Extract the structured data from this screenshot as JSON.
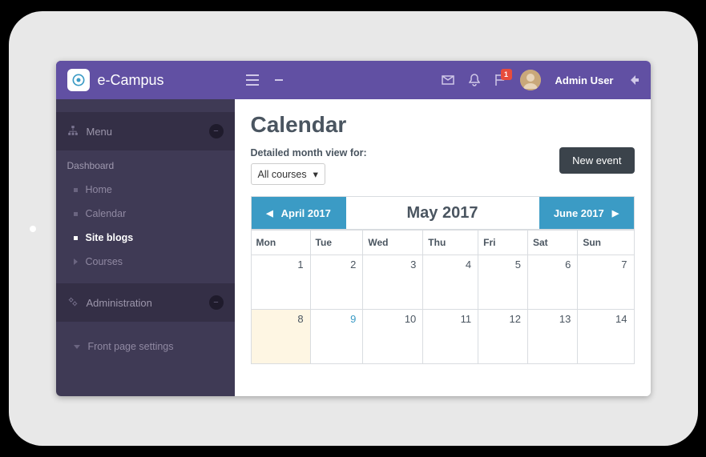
{
  "brand": {
    "name": "e-Campus"
  },
  "sidebar": {
    "menu_label": "Menu",
    "group1_title": "Dashboard",
    "items": [
      {
        "label": "Home",
        "active": false
      },
      {
        "label": "Calendar",
        "active": false
      },
      {
        "label": "Site blogs",
        "active": true
      },
      {
        "label": "Courses",
        "active": false,
        "icon": "tri"
      }
    ],
    "admin_label": "Administration",
    "front_page_label": "Front page settings"
  },
  "topbar": {
    "badge": "1",
    "username": "Admin User"
  },
  "page": {
    "title": "Calendar",
    "filter_label": "Detailed month view for:",
    "filter_value": "All courses",
    "new_event": "New event"
  },
  "calendar": {
    "prev": "April 2017",
    "current": "May 2017",
    "next": "June 2017",
    "days": [
      "Mon",
      "Tue",
      "Wed",
      "Thu",
      "Fri",
      "Sat",
      "Sun"
    ],
    "rows": [
      [
        {
          "n": "1"
        },
        {
          "n": "2"
        },
        {
          "n": "3"
        },
        {
          "n": "4"
        },
        {
          "n": "5"
        },
        {
          "n": "6"
        },
        {
          "n": "7"
        }
      ],
      [
        {
          "n": "8",
          "today": true
        },
        {
          "n": "9",
          "highlight": true
        },
        {
          "n": "10"
        },
        {
          "n": "11"
        },
        {
          "n": "12"
        },
        {
          "n": "13"
        },
        {
          "n": "14"
        }
      ]
    ]
  }
}
